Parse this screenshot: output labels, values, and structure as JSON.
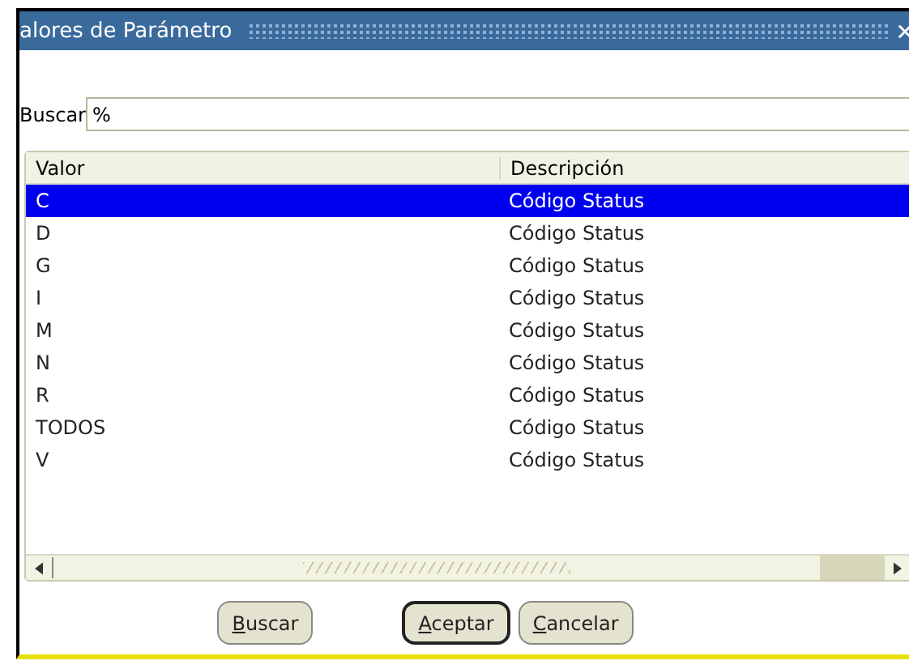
{
  "window": {
    "title": "alores de Parámetro"
  },
  "search": {
    "label": "Buscar",
    "value": "%"
  },
  "table": {
    "columns": [
      "Valor",
      "Descripción"
    ],
    "rows": [
      {
        "cells": [
          "C",
          "Código Status"
        ],
        "selected": true
      },
      {
        "cells": [
          "D",
          "Código Status"
        ],
        "selected": false
      },
      {
        "cells": [
          "G",
          "Código Status"
        ],
        "selected": false
      },
      {
        "cells": [
          "I",
          "Código Status"
        ],
        "selected": false
      },
      {
        "cells": [
          "M",
          "Código Status"
        ],
        "selected": false
      },
      {
        "cells": [
          "N",
          "Código Status"
        ],
        "selected": false
      },
      {
        "cells": [
          "R",
          "Código Status"
        ],
        "selected": false
      },
      {
        "cells": [
          "TODOS",
          "Código Status"
        ],
        "selected": false
      },
      {
        "cells": [
          "V",
          "Código Status"
        ],
        "selected": false
      }
    ]
  },
  "buttons": [
    {
      "label": "Buscar",
      "default": false
    },
    {
      "label": "Aceptar",
      "default": true
    },
    {
      "label": "Cancelar",
      "default": false
    }
  ]
}
